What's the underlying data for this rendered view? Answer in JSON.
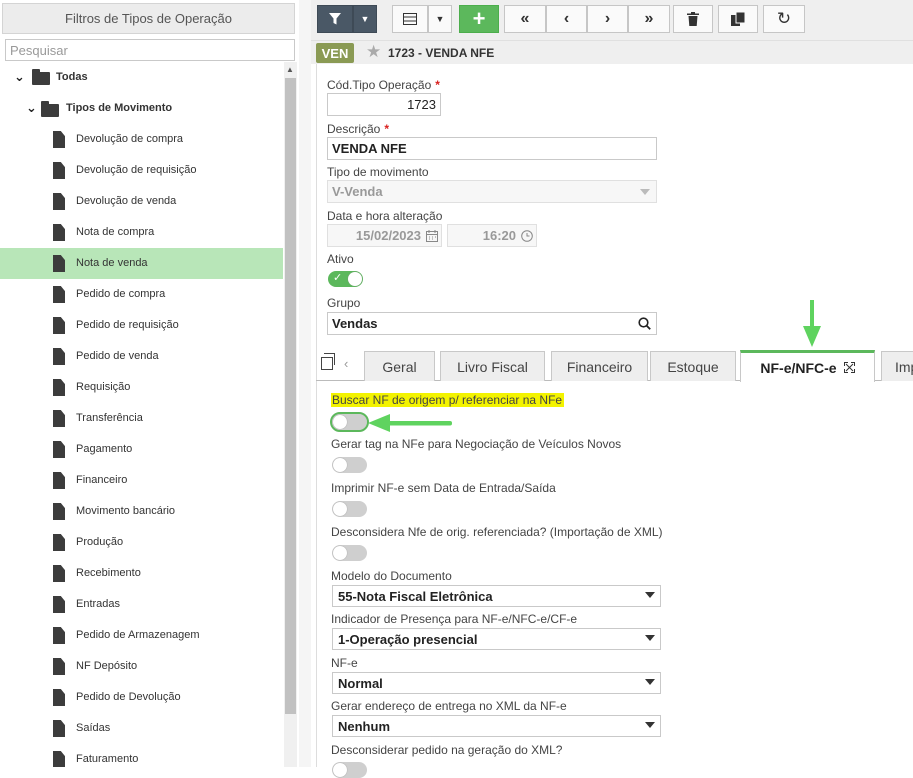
{
  "sidebar": {
    "header": "Filtros de Tipos de Operação",
    "search_placeholder": "Pesquisar",
    "root_label": "Todas",
    "group_label": "Tipos de Movimento",
    "items": [
      {
        "label": "Devolução de compra"
      },
      {
        "label": "Devolução de requisição"
      },
      {
        "label": "Devolução de venda"
      },
      {
        "label": "Nota de compra"
      },
      {
        "label": "Nota de venda",
        "selected": true
      },
      {
        "label": "Pedido de compra"
      },
      {
        "label": "Pedido de requisição"
      },
      {
        "label": "Pedido de venda"
      },
      {
        "label": "Requisição"
      },
      {
        "label": "Transferência"
      },
      {
        "label": "Pagamento"
      },
      {
        "label": "Financeiro"
      },
      {
        "label": "Movimento bancário"
      },
      {
        "label": "Produção"
      },
      {
        "label": "Recebimento"
      },
      {
        "label": "Entradas"
      },
      {
        "label": "Pedido de Armazenagem"
      },
      {
        "label": "NF Depósito"
      },
      {
        "label": "Pedido de Devolução"
      },
      {
        "label": "Saídas"
      },
      {
        "label": "Faturamento"
      }
    ]
  },
  "toolbar": {
    "icons": [
      "filter-icon",
      "caret-down-icon",
      "grid-icon",
      "caret-down-icon",
      "plus-icon",
      "first-icon",
      "prev-icon",
      "next-icon",
      "last-icon",
      "trash-icon",
      "copy-icon",
      "refresh-icon"
    ]
  },
  "header": {
    "badge": "VEN",
    "title": "1723 - VENDA NFE"
  },
  "form": {
    "cod_label": "Cód.Tipo Operação",
    "cod_value": "1723",
    "desc_label": "Descrição",
    "desc_value": "VENDA NFE",
    "tipo_label": "Tipo de movimento",
    "tipo_value": "V-Venda",
    "data_label": "Data e hora alteração",
    "data_value": "15/02/2023",
    "hora_value": "16:20",
    "ativo_label": "Ativo",
    "grupo_label": "Grupo",
    "grupo_value": "Vendas",
    "required_mark": "*"
  },
  "tabs": [
    {
      "label": "Geral"
    },
    {
      "label": "Livro Fiscal"
    },
    {
      "label": "Financeiro"
    },
    {
      "label": "Estoque"
    },
    {
      "label": "NF-e/NFC-e",
      "active": true
    },
    {
      "label": "Imp"
    }
  ],
  "nfe": {
    "buscar_label": "Buscar NF de origem p/ referenciar na NFe",
    "gerar_tag_label": "Gerar tag na NFe para Negociação de Veículos Novos",
    "imprimir_label": "Imprimir NF-e sem Data de Entrada/Saída",
    "desconsidera_label": "Desconsidera Nfe de orig. referenciada? (Importação de XML)",
    "modelo_label": "Modelo do Documento",
    "modelo_value": "55-Nota Fiscal Eletrônica",
    "indicador_label": "Indicador de Presença para NF-e/NFC-e/CF-e",
    "indicador_value": "1-Operação presencial",
    "nfe_label": "NF-e",
    "nfe_value": "Normal",
    "endereco_label": "Gerar endereço de entrega no XML da NF-e",
    "endereco_value": "Nenhum",
    "pedido_label": "Desconsiderar pedido na geração do XML?"
  },
  "colors": {
    "accent_green": "#5cb85c",
    "selected_row": "#b8e6b8",
    "badge": "#8a9a54",
    "highlight": "#f3f300"
  }
}
